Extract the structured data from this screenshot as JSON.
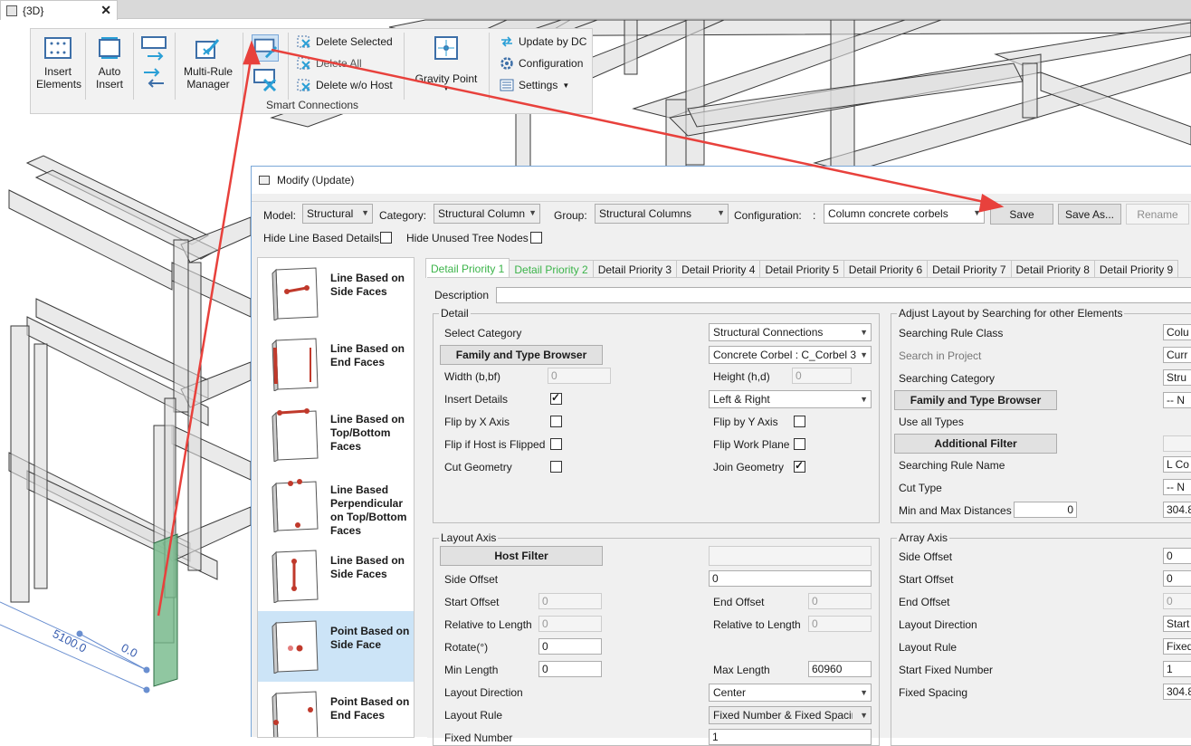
{
  "view_tab": {
    "title": "{3D}",
    "close": "✕"
  },
  "ribbon": {
    "insert_elements": "Insert Elements",
    "auto_insert": "Auto Insert",
    "multi_rule_manager": "Multi-Rule Manager",
    "delete_selected": "Delete Selected",
    "delete_all": "Delete All",
    "delete_wo_host": "Delete w/o Host",
    "gravity_point": "Gravity Point",
    "update_by_dc": "Update by DC",
    "configuration": "Configuration",
    "settings": "Settings",
    "panel_title": "Smart Connections"
  },
  "dimensions": {
    "length": "5100.0",
    "offset": "0.0"
  },
  "dialog": {
    "title": "Modify (Update)",
    "model_label": "Model:",
    "model_value": "Structural",
    "category_label": "Category:",
    "category_value": "Structural Columns",
    "group_label": "Group:",
    "group_value": "Structural Columns",
    "configuration_label": "Configuration:",
    "configuration_sep": ":",
    "configuration_value": "Column concrete corbels",
    "save": "Save",
    "save_as": "Save As...",
    "rename": "Rename",
    "hide_line_based": "Hide Line Based Details",
    "hide_unused": "Hide Unused Tree Nodes"
  },
  "left_list": [
    {
      "label": "Line Based on Side Faces"
    },
    {
      "label": "Line Based on End Faces"
    },
    {
      "label": "Line Based on Top/Bottom Faces"
    },
    {
      "label": "Line Based Perpendicular on Top/Bottom Faces"
    },
    {
      "label": "Line Based on Side Faces"
    },
    {
      "label": "Point Based on Side Face"
    },
    {
      "label": "Point Based on End Faces"
    }
  ],
  "tabs": [
    "Detail Priority 1",
    "Detail Priority 2",
    "Detail Priority 3",
    "Detail Priority 4",
    "Detail Priority 5",
    "Detail Priority 6",
    "Detail Priority 7",
    "Detail Priority 8",
    "Detail Priority 9"
  ],
  "detail": {
    "description_label": "Description",
    "group_title": "Detail",
    "select_category": "Select Category",
    "select_category_value": "Structural Connections",
    "family_type_browser": "Family and Type Browser",
    "family_type_value": "Concrete Corbel : C_Corbel 3",
    "width_label": "Width (b,bf)",
    "width_value": "0",
    "height_label": "Height (h,d)",
    "height_value": "0",
    "insert_details": "Insert Details",
    "left_right": "Left & Right",
    "flip_x": "Flip by X Axis",
    "flip_y": "Flip by Y Axis",
    "flip_host": "Flip if Host is Flipped",
    "flip_work": "Flip Work Plane",
    "cut_geometry": "Cut Geometry",
    "join_geometry": "Join Geometry"
  },
  "layout_axis": {
    "group_title": "Layout Axis",
    "host_filter": "Host Filter",
    "side_offset": "Side Offset",
    "side_offset_value": "0",
    "start_offset": "Start Offset",
    "start_offset_value": "0",
    "end_offset": "End Offset",
    "end_offset_value": "0",
    "rel_length_1": "Relative to Length",
    "rel_length_1_value": "0",
    "rel_length_2": "Relative to Length",
    "rel_length_2_value": "0",
    "rotate": "Rotate(°)",
    "rotate_value": "0",
    "min_length": "Min Length",
    "min_length_value": "0",
    "max_length": "Max Length",
    "max_length_value": "60960",
    "layout_direction": "Layout Direction",
    "layout_direction_value": "Center",
    "layout_rule": "Layout Rule",
    "layout_rule_value": "Fixed Number & Fixed Spacing",
    "fixed_number": "Fixed Number",
    "fixed_number_value": "1"
  },
  "adjust": {
    "group_title": "Adjust Layout by Searching for other Elements",
    "searching_rule_class": "Searching Rule Class",
    "searching_rule_class_value": "Colu",
    "search_in_project": "Search in Project",
    "search_in_project_value": "Curr",
    "searching_category": "Searching Category",
    "searching_category_value": "Stru",
    "family_type_browser": "Family and Type Browser",
    "ftb_value": "-- N",
    "use_all_types": "Use all Types",
    "additional_filter": "Additional Filter",
    "searching_rule_name": "Searching Rule Name",
    "searching_rule_name_value": "L Co",
    "cut_type": "Cut Type",
    "cut_type_value": "-- N",
    "min_max": "Min and Max Distances",
    "min_value": "0",
    "max_value": "304.8"
  },
  "array_axis": {
    "group_title": "Array Axis",
    "side_offset": "Side Offset",
    "side_offset_value": "0",
    "start_offset": "Start Offset",
    "start_offset_value": "0",
    "end_offset": "End Offset",
    "end_offset_value": "0",
    "layout_direction": "Layout Direction",
    "layout_direction_value": "Start",
    "layout_rule": "Layout Rule",
    "layout_rule_value": "Fixed",
    "start_fixed_number": "Start Fixed Number",
    "start_fixed_number_value": "1",
    "fixed_spacing": "Fixed Spacing",
    "fixed_spacing_value": "304.8"
  },
  "colors": {
    "arrow": "#e8413c",
    "accent_green": "#3cb44a",
    "selection": "#cce4f7"
  }
}
